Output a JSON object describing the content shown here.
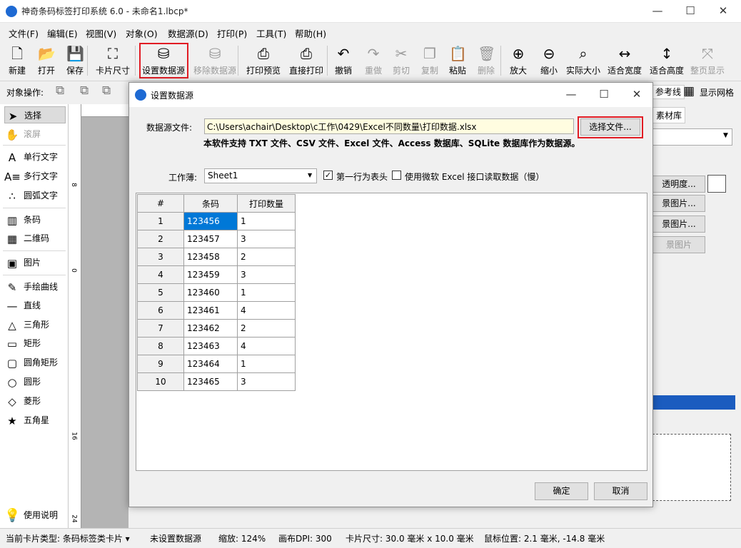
{
  "window": {
    "title": "神奇条码标签打印系统 6.0 - 未命名1.lbcp*",
    "min": "—",
    "max": "☐",
    "close": "✕"
  },
  "menu": [
    "文件(F)",
    "编辑(E)",
    "视图(V)",
    "对象(O)",
    "数据源(D)",
    "打印(P)",
    "工具(T)",
    "帮助(H)"
  ],
  "toolbar": [
    {
      "label": "新建",
      "icon": "new-file-icon",
      "glyph": "🗋",
      "enabled": true
    },
    {
      "label": "打开",
      "icon": "open-folder-icon",
      "glyph": "📂",
      "enabled": true
    },
    {
      "label": "保存",
      "icon": "save-icon",
      "glyph": "💾",
      "enabled": true
    },
    {
      "label": "卡片尺寸",
      "icon": "card-size-icon",
      "glyph": "⛶",
      "enabled": true
    },
    {
      "label": "设置数据源",
      "icon": "database-icon",
      "glyph": "⛁",
      "enabled": true
    },
    {
      "label": "移除数据源",
      "icon": "remove-database-icon",
      "glyph": "⛁",
      "enabled": false
    },
    {
      "label": "打印预览",
      "icon": "print-preview-icon",
      "glyph": "⎙",
      "enabled": true
    },
    {
      "label": "直接打印",
      "icon": "printer-icon",
      "glyph": "⎙",
      "enabled": true
    },
    {
      "label": "撤销",
      "icon": "undo-icon",
      "glyph": "↶",
      "enabled": true
    },
    {
      "label": "重做",
      "icon": "redo-icon",
      "glyph": "↷",
      "enabled": false
    },
    {
      "label": "剪切",
      "icon": "cut-icon",
      "glyph": "✂",
      "enabled": false
    },
    {
      "label": "复制",
      "icon": "copy-icon",
      "glyph": "❐",
      "enabled": false
    },
    {
      "label": "粘贴",
      "icon": "paste-icon",
      "glyph": "📋",
      "enabled": true
    },
    {
      "label": "删除",
      "icon": "delete-icon",
      "glyph": "🗑",
      "enabled": false
    },
    {
      "label": "放大",
      "icon": "zoom-in-icon",
      "glyph": "⊕",
      "enabled": true
    },
    {
      "label": "缩小",
      "icon": "zoom-out-icon",
      "glyph": "⊖",
      "enabled": true
    },
    {
      "label": "实际大小",
      "icon": "actual-size-icon",
      "glyph": "⌕",
      "enabled": true
    },
    {
      "label": "适合宽度",
      "icon": "fit-width-icon",
      "glyph": "↔",
      "enabled": true
    },
    {
      "label": "适合高度",
      "icon": "fit-height-icon",
      "glyph": "↕",
      "enabled": true
    },
    {
      "label": "整页显示",
      "icon": "fit-page-icon",
      "glyph": "⤧",
      "enabled": false
    }
  ],
  "objbar": {
    "label": "对象操作:",
    "ref_line": "参考线",
    "show_grid": "显示网格"
  },
  "tools": [
    {
      "label": "选择",
      "icon": "cursor-arrow-icon",
      "glyph": "➤",
      "selected": true
    },
    {
      "label": "滚屏",
      "icon": "hand-scroll-icon",
      "glyph": "✋",
      "selected": false
    },
    {
      "label": "单行文字",
      "icon": "single-line-text-icon",
      "glyph": "A",
      "selected": false
    },
    {
      "label": "多行文字",
      "icon": "multi-line-text-icon",
      "glyph": "A≡",
      "selected": false
    },
    {
      "label": "圆弧文字",
      "icon": "arc-text-icon",
      "glyph": "∴",
      "selected": false
    },
    {
      "label": "条码",
      "icon": "barcode-icon",
      "glyph": "▥",
      "selected": false
    },
    {
      "label": "二维码",
      "icon": "qrcode-icon",
      "glyph": "▦",
      "selected": false
    },
    {
      "label": "图片",
      "icon": "image-icon",
      "glyph": "▣",
      "selected": false
    },
    {
      "label": "手绘曲线",
      "icon": "pen-curve-icon",
      "glyph": "✎",
      "selected": false
    },
    {
      "label": "直线",
      "icon": "line-icon",
      "glyph": "—",
      "selected": false
    },
    {
      "label": "三角形",
      "icon": "triangle-icon",
      "glyph": "△",
      "selected": false
    },
    {
      "label": "矩形",
      "icon": "rectangle-icon",
      "glyph": "▭",
      "selected": false
    },
    {
      "label": "圆角矩形",
      "icon": "rounded-rect-icon",
      "glyph": "▢",
      "selected": false
    },
    {
      "label": "圆形",
      "icon": "circle-icon",
      "glyph": "○",
      "selected": false
    },
    {
      "label": "菱形",
      "icon": "diamond-icon",
      "glyph": "◇",
      "selected": false
    },
    {
      "label": "五角星",
      "icon": "star-icon",
      "glyph": "★",
      "selected": false
    }
  ],
  "help": {
    "label": "使用说明",
    "glyph": "💡"
  },
  "ruler_marks": [
    "8",
    "0",
    "16",
    "24"
  ],
  "right_panel": {
    "tab": "素材库",
    "transparency": "透明度...",
    "bg_image1": "景图片...",
    "bg_image2": "景图片...",
    "bg_image3": "景图片"
  },
  "dialog": {
    "title": "设置数据源",
    "file_label": "数据源文件:",
    "file_path": "C:\\Users\\achair\\Desktop\\c工作\\0429\\Excel不同数量\\打印数据.xlsx",
    "choose_file": "选择文件...",
    "support_note": "本软件支持 TXT 文件、CSV 文件、Excel 文件、Access 数据库、SQLite 数据库作为数据源。",
    "sheet_label": "工作薄:",
    "sheet_value": "Sheet1",
    "first_row_header": "第一行为表头",
    "first_row_checked": true,
    "use_ms_excel": "使用微软 Excel 接口读取数据（慢）",
    "use_ms_checked": false,
    "columns": [
      "#",
      "条码",
      "打印数量"
    ],
    "rows": [
      [
        "1",
        "123456",
        "1"
      ],
      [
        "2",
        "123457",
        "3"
      ],
      [
        "3",
        "123458",
        "2"
      ],
      [
        "4",
        "123459",
        "3"
      ],
      [
        "5",
        "123460",
        "1"
      ],
      [
        "6",
        "123461",
        "4"
      ],
      [
        "7",
        "123462",
        "2"
      ],
      [
        "8",
        "123463",
        "4"
      ],
      [
        "9",
        "123464",
        "1"
      ],
      [
        "10",
        "123465",
        "3"
      ]
    ],
    "ok": "确定",
    "cancel": "取消"
  },
  "status": {
    "card_type": "当前卡片类型: 条码标签类卡片 ▾",
    "datasource": "未设置数据源",
    "zoom": "缩放: 124%",
    "dpi": "画布DPI: 300",
    "card_size": "卡片尺寸: 30.0 毫米 x 10.0 毫米",
    "mouse_pos": "鼠标位置: 2.1 毫米, -14.8 毫米"
  },
  "colors": {
    "accent": "#0078d7",
    "highlight": "#e11c24",
    "app_icon": "#1e6ad3"
  }
}
